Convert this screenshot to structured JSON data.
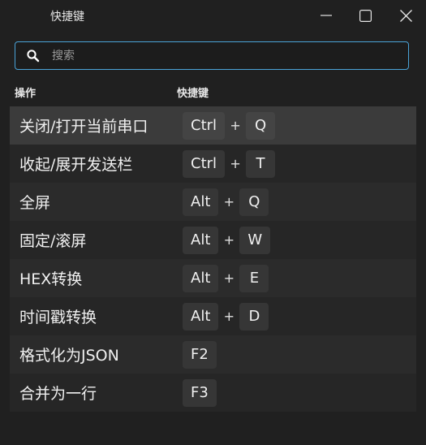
{
  "window": {
    "title": "快捷键",
    "minimize_icon": "minimize-icon",
    "maximize_icon": "maximize-icon",
    "close_icon": "close-icon"
  },
  "search": {
    "placeholder": "搜索",
    "value": "",
    "icon": "search-icon",
    "border_color": "#4aa3d8"
  },
  "table": {
    "headers": {
      "action": "操作",
      "shortcut": "快捷键"
    },
    "rows": [
      {
        "action": "关闭/打开当前串口",
        "keys": [
          "Ctrl",
          "Q"
        ],
        "selected": true
      },
      {
        "action": "收起/展开发送栏",
        "keys": [
          "Ctrl",
          "T"
        ]
      },
      {
        "action": "全屏",
        "keys": [
          "Alt",
          "Q"
        ]
      },
      {
        "action": "固定/滚屏",
        "keys": [
          "Alt",
          "W"
        ]
      },
      {
        "action": "HEX转换",
        "keys": [
          "Alt",
          "E"
        ]
      },
      {
        "action": "时间戳转换",
        "keys": [
          "Alt",
          "D"
        ]
      },
      {
        "action": "格式化为JSON",
        "keys": [
          "F2"
        ]
      },
      {
        "action": "合并为一行",
        "keys": [
          "F3"
        ]
      }
    ],
    "plus_symbol": "+"
  }
}
